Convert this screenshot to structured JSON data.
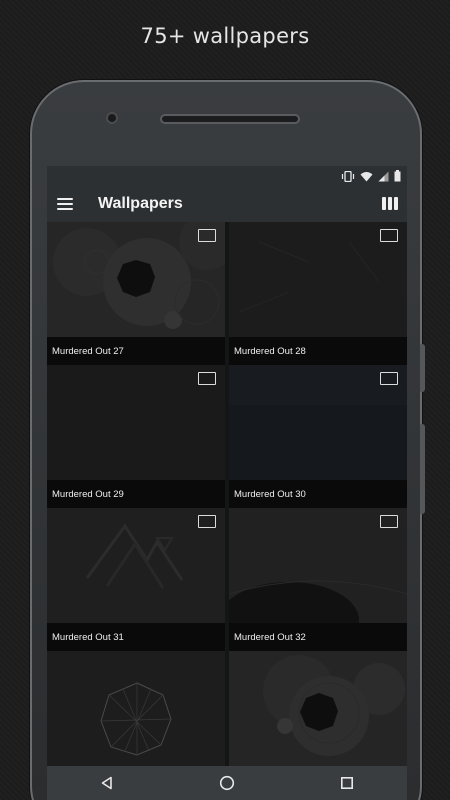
{
  "promo": {
    "headline": "75+ wallpapers"
  },
  "appbar": {
    "title": "Wallpapers",
    "menu_icon": "hamburger-menu-icon",
    "view_toggle_icon": "columns-view-icon"
  },
  "statusbar": {
    "icons": [
      "vibrate-icon",
      "wifi-icon",
      "signal-icon",
      "battery-icon"
    ]
  },
  "wallpapers": [
    {
      "name": "Murdered Out 27"
    },
    {
      "name": "Murdered Out 28"
    },
    {
      "name": "Murdered Out 29"
    },
    {
      "name": "Murdered Out 30"
    },
    {
      "name": "Murdered Out 31"
    },
    {
      "name": "Murdered Out 32"
    }
  ],
  "navbar": {
    "icons": [
      "back-icon",
      "home-icon",
      "recents-icon"
    ]
  },
  "colors": {
    "background": "#1c1c1c",
    "appbar": "#2d3033",
    "caption": "#0a0a0a"
  }
}
